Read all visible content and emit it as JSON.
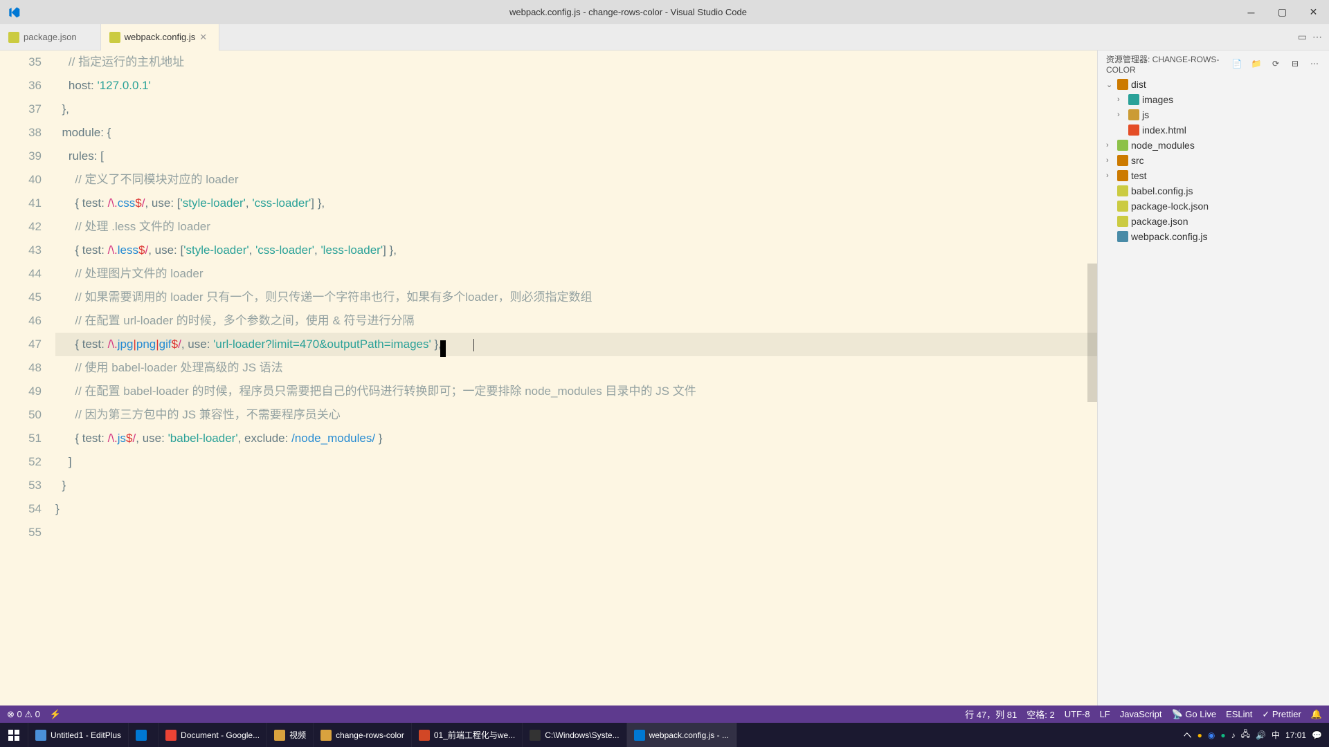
{
  "titlebar": {
    "title": "webpack.config.js - change-rows-color - Visual Studio Code"
  },
  "tabs": [
    {
      "label": "package.json",
      "active": false
    },
    {
      "label": "webpack.config.js",
      "active": true
    }
  ],
  "sidebar": {
    "title": "资源管理器: CHANGE-ROWS-COLOR",
    "tree": [
      {
        "type": "folder",
        "name": "dist",
        "expanded": true,
        "indent": 0,
        "color": "#cc7a00"
      },
      {
        "type": "folder",
        "name": "images",
        "expanded": false,
        "indent": 1,
        "color": "#2aa198"
      },
      {
        "type": "folder",
        "name": "js",
        "expanded": false,
        "indent": 1,
        "color": "#cb9b34"
      },
      {
        "type": "file",
        "name": "index.html",
        "indent": 1,
        "color": "#e44d26"
      },
      {
        "type": "folder",
        "name": "node_modules",
        "expanded": false,
        "indent": 0,
        "color": "#8dc149"
      },
      {
        "type": "folder",
        "name": "src",
        "expanded": false,
        "indent": 0,
        "color": "#cc7a00"
      },
      {
        "type": "folder",
        "name": "test",
        "expanded": false,
        "indent": 0,
        "color": "#cc7a00"
      },
      {
        "type": "file",
        "name": "babel.config.js",
        "indent": 0,
        "color": "#cbcb41"
      },
      {
        "type": "file",
        "name": "package-lock.json",
        "indent": 0,
        "color": "#cbcb41"
      },
      {
        "type": "file",
        "name": "package.json",
        "indent": 0,
        "color": "#cbcb41"
      },
      {
        "type": "file",
        "name": "webpack.config.js",
        "indent": 0,
        "color": "#498ba7"
      }
    ]
  },
  "editor": {
    "startLine": 35,
    "highlightLine": 47,
    "lines": [
      {
        "num": 35,
        "tokens": [
          {
            "t": "    ",
            "c": ""
          },
          {
            "t": "// 指定运行的主机地址",
            "c": "cmt"
          }
        ]
      },
      {
        "num": 36,
        "tokens": [
          {
            "t": "    host: ",
            "c": ""
          },
          {
            "t": "'127.0.0.1'",
            "c": "str"
          }
        ]
      },
      {
        "num": 37,
        "tokens": [
          {
            "t": "  },",
            "c": ""
          }
        ]
      },
      {
        "num": 38,
        "tokens": [
          {
            "t": "  module: {",
            "c": ""
          }
        ]
      },
      {
        "num": 39,
        "tokens": [
          {
            "t": "    rules: [",
            "c": ""
          }
        ]
      },
      {
        "num": 40,
        "tokens": [
          {
            "t": "      ",
            "c": ""
          },
          {
            "t": "// 定义了不同模块对应的 loader",
            "c": "cmt"
          }
        ]
      },
      {
        "num": 41,
        "tokens": [
          {
            "t": "      { test: ",
            "c": ""
          },
          {
            "t": "/\\.",
            "c": "re-slash"
          },
          {
            "t": "css",
            "c": "cls"
          },
          {
            "t": "$",
            "c": "re-end"
          },
          {
            "t": "/",
            "c": "re-slash"
          },
          {
            "t": ", use: [",
            "c": ""
          },
          {
            "t": "'style-loader'",
            "c": "str"
          },
          {
            "t": ", ",
            "c": ""
          },
          {
            "t": "'css-loader'",
            "c": "str"
          },
          {
            "t": "] },",
            "c": ""
          }
        ]
      },
      {
        "num": 42,
        "tokens": [
          {
            "t": "      ",
            "c": ""
          },
          {
            "t": "// 处理 .less 文件的 loader",
            "c": "cmt"
          }
        ]
      },
      {
        "num": 43,
        "tokens": [
          {
            "t": "      { test: ",
            "c": ""
          },
          {
            "t": "/\\.",
            "c": "re-slash"
          },
          {
            "t": "less",
            "c": "cls"
          },
          {
            "t": "$",
            "c": "re-end"
          },
          {
            "t": "/",
            "c": "re-slash"
          },
          {
            "t": ", use: [",
            "c": ""
          },
          {
            "t": "'style-loader'",
            "c": "str"
          },
          {
            "t": ", ",
            "c": ""
          },
          {
            "t": "'css-loader'",
            "c": "str"
          },
          {
            "t": ", ",
            "c": ""
          },
          {
            "t": "'less-loader'",
            "c": "str"
          },
          {
            "t": "] },",
            "c": ""
          }
        ]
      },
      {
        "num": 44,
        "tokens": [
          {
            "t": "      ",
            "c": ""
          },
          {
            "t": "// 处理图片文件的 loader",
            "c": "cmt"
          }
        ]
      },
      {
        "num": 45,
        "tokens": [
          {
            "t": "      ",
            "c": ""
          },
          {
            "t": "// 如果需要调用的 loader 只有一个，则只传递一个字符串也行，如果有多个loader，则必须指定数组",
            "c": "cmt"
          }
        ]
      },
      {
        "num": 46,
        "tokens": [
          {
            "t": "      ",
            "c": ""
          },
          {
            "t": "// 在配置 url-loader 的时候，多个参数之间，使用 & 符号进行分隔",
            "c": "cmt"
          }
        ]
      },
      {
        "num": 47,
        "tokens": [
          {
            "t": "      { test: ",
            "c": ""
          },
          {
            "t": "/\\.",
            "c": "re-slash"
          },
          {
            "t": "jpg",
            "c": "cls"
          },
          {
            "t": "|",
            "c": "re-end"
          },
          {
            "t": "png",
            "c": "cls"
          },
          {
            "t": "|",
            "c": "re-end"
          },
          {
            "t": "gif",
            "c": "cls"
          },
          {
            "t": "$",
            "c": "re-end"
          },
          {
            "t": "/",
            "c": "re-slash"
          },
          {
            "t": ", use: ",
            "c": ""
          },
          {
            "t": "'url-loader?limit=470&outputPath=images'",
            "c": "str"
          },
          {
            "t": " },",
            "c": ""
          }
        ]
      },
      {
        "num": 48,
        "tokens": [
          {
            "t": "      ",
            "c": ""
          },
          {
            "t": "// 使用 babel-loader 处理高级的 JS 语法",
            "c": "cmt"
          }
        ]
      },
      {
        "num": 49,
        "tokens": [
          {
            "t": "      ",
            "c": ""
          },
          {
            "t": "// 在配置 babel-loader 的时候，程序员只需要把自己的代码进行转换即可；一定要排除 node_modules 目录中的 JS 文件",
            "c": "cmt"
          }
        ]
      },
      {
        "num": 50,
        "tokens": [
          {
            "t": "      ",
            "c": ""
          },
          {
            "t": "// 因为第三方包中的 JS 兼容性，不需要程序员关心",
            "c": "cmt"
          }
        ]
      },
      {
        "num": 51,
        "tokens": [
          {
            "t": "      { test: ",
            "c": ""
          },
          {
            "t": "/\\.",
            "c": "re-slash"
          },
          {
            "t": "js",
            "c": "cls"
          },
          {
            "t": "$",
            "c": "re-end"
          },
          {
            "t": "/",
            "c": "re-slash"
          },
          {
            "t": ", use: ",
            "c": ""
          },
          {
            "t": "'babel-loader'",
            "c": "str"
          },
          {
            "t": ", exclude: ",
            "c": ""
          },
          {
            "t": "/node_modules/",
            "c": "cls"
          },
          {
            "t": " }",
            "c": ""
          }
        ]
      },
      {
        "num": 52,
        "tokens": [
          {
            "t": "    ]",
            "c": ""
          }
        ]
      },
      {
        "num": 53,
        "tokens": [
          {
            "t": "  }",
            "c": ""
          }
        ]
      },
      {
        "num": 54,
        "tokens": [
          {
            "t": "}",
            "c": ""
          }
        ]
      },
      {
        "num": 55,
        "tokens": [
          {
            "t": "",
            "c": ""
          }
        ]
      }
    ]
  },
  "statusbar": {
    "errors": "0",
    "warnings": "0",
    "port_icon": "⚡",
    "cursor": "行 47，列 81",
    "spaces": "空格: 2",
    "encoding": "UTF-8",
    "eol": "LF",
    "lang": "JavaScript",
    "golive": "Go Live",
    "eslint": "ESLint",
    "prettier": "Prettier"
  },
  "taskbar": {
    "items": [
      {
        "label": "Untitled1 - EditPlus",
        "icon": "#4a90d9"
      },
      {
        "label": "",
        "icon": "#0078d4"
      },
      {
        "label": "Document - Google...",
        "icon": "#ea4335"
      },
      {
        "label": "视频",
        "icon": "#d9a23e"
      },
      {
        "label": "change-rows-color",
        "icon": "#d9a23e"
      },
      {
        "label": "01_前端工程化与we...",
        "icon": "#d24726"
      },
      {
        "label": "C:\\Windows\\Syste...",
        "icon": "#333"
      },
      {
        "label": "webpack.config.js - ...",
        "icon": "#0078d4",
        "active": true
      }
    ],
    "time": "17:01",
    "ime": "中"
  }
}
